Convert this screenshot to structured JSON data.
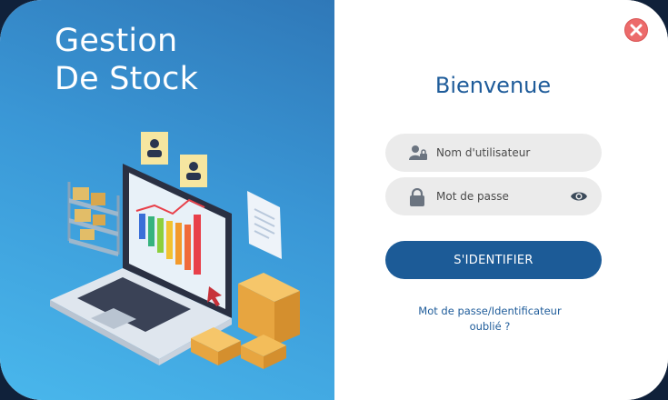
{
  "branding": {
    "title_line1": "Gestion",
    "title_line2": "De Stock",
    "illustration": "laptop-inventory-illustration"
  },
  "colors": {
    "panel_gradient_start": "#2f78b8",
    "panel_gradient_end": "#49b7ec",
    "accent": "#1c5b97",
    "close": "#ec6b6b",
    "field_bg": "#ebebeb"
  },
  "login": {
    "welcome": "Bienvenue",
    "username": {
      "placeholder": "Nom d'utilisateur",
      "value": "",
      "icon": "user-lock-icon"
    },
    "password": {
      "placeholder": "Mot de passe",
      "value": "",
      "icon": "padlock-icon",
      "toggle_icon": "eye-icon"
    },
    "submit_label": "S'IDENTIFIER",
    "forgot_line1": "Mot de passe/Identificateur",
    "forgot_line2": "oublié ?"
  },
  "window": {
    "close_icon": "close-icon"
  }
}
